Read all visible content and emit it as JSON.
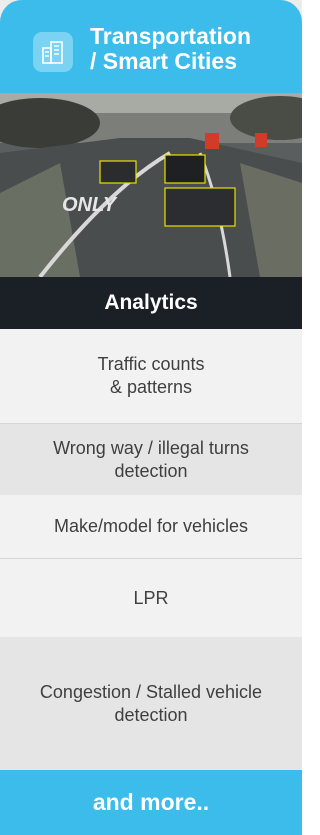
{
  "header": {
    "title": "Transportation\n/ Smart Cities",
    "icon": "city-buildings-icon",
    "color": "#3bbcea"
  },
  "image": {
    "road_text": "ONLY"
  },
  "analytics": {
    "label": "Analytics"
  },
  "items": [
    {
      "label": "Traffic counts\n& patterns"
    },
    {
      "label": "Wrong way / illegal turns\ndetection"
    },
    {
      "label": "Make/model for vehicles"
    },
    {
      "label": "LPR"
    },
    {
      "label": "Congestion / Stalled vehicle\ndetection"
    }
  ],
  "footer": {
    "label": "and more.."
  }
}
